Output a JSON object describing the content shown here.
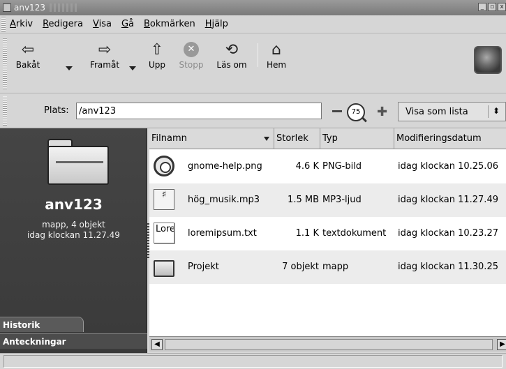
{
  "window": {
    "title": "anv123",
    "buttons": [
      "_",
      "▫",
      "x"
    ]
  },
  "menubar": [
    "Arkiv",
    "Redigera",
    "Visa",
    "Gå",
    "Bokmärken",
    "Hjälp"
  ],
  "toolbar": {
    "back": "Bakåt",
    "forward": "Framåt",
    "up": "Upp",
    "stop": "Stopp",
    "reload": "Läs om",
    "home": "Hem"
  },
  "location": {
    "label": "Plats:",
    "value": "/anv123",
    "zoom": "75",
    "view_mode": "Visa som lista"
  },
  "sidepane": {
    "name": "anv123",
    "info_line1": "mapp, 4 objekt",
    "info_line2": "idag klockan 11.27.49",
    "tabs": [
      "Historik",
      "Anteckningar"
    ]
  },
  "columns": {
    "name": "Filnamn",
    "size": "Storlek",
    "type": "Typ",
    "modified": "Modifieringsdatum"
  },
  "files": [
    {
      "name": "gnome-help.png",
      "size": "4.6 K",
      "type": "PNG-bild",
      "modified": "idag klockan 10.25.06",
      "icon": "help-icon"
    },
    {
      "name": "hög_musik.mp3",
      "size": "1.5 MB",
      "type": "MP3-ljud",
      "modified": "idag klockan 11.27.49",
      "icon": "music-file-icon"
    },
    {
      "name": "loremipsum.txt",
      "size": "1.1 K",
      "type": "textdokument",
      "modified": "idag klockan 10.23.27",
      "icon": "text-file-icon",
      "icon_text": "Lore"
    },
    {
      "name": "Projekt",
      "size": "7 objekt",
      "type": "mapp",
      "modified": "idag klockan 11.30.25",
      "icon": "folder-icon"
    }
  ]
}
